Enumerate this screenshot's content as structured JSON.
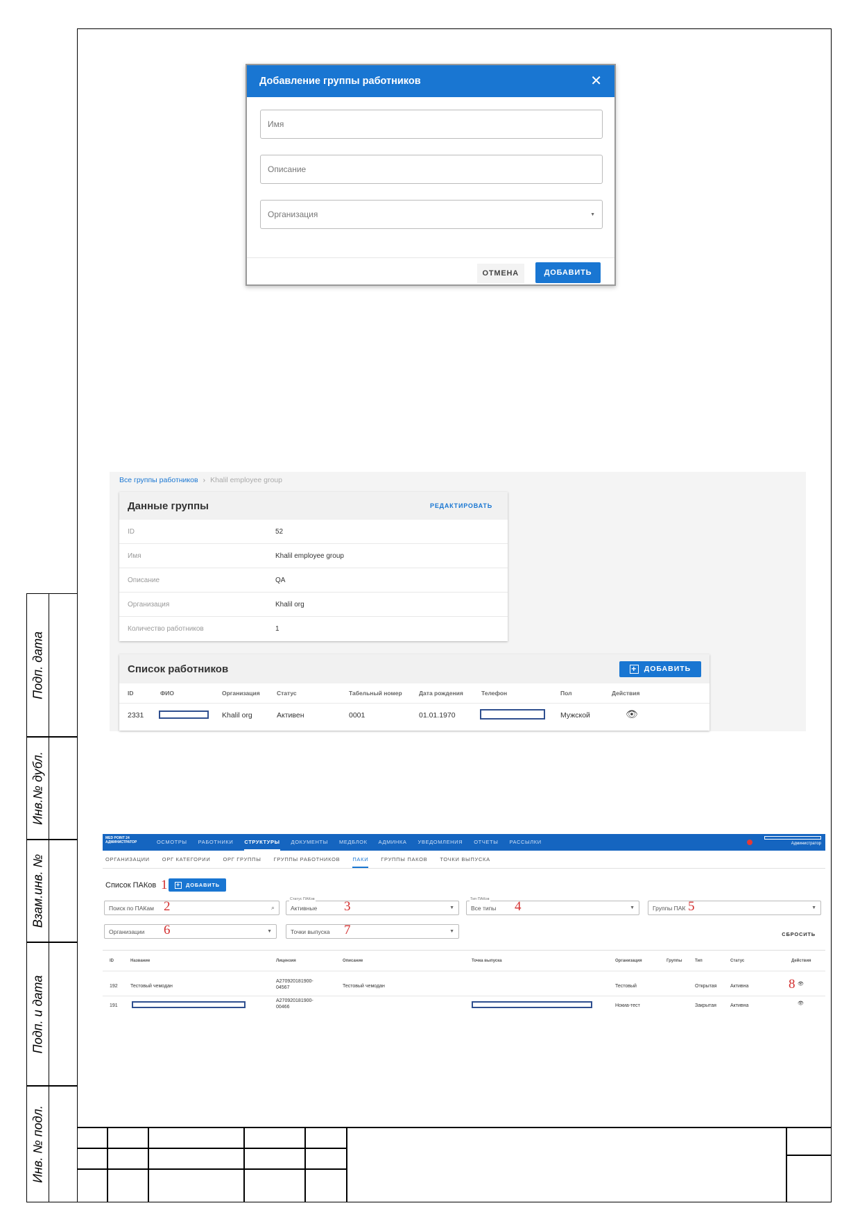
{
  "stamp": {
    "labels": [
      "Подп. дата",
      "Инв.№ дубл.",
      "Взам.инв. №",
      "Подп. и дата",
      "Инв. № подл."
    ]
  },
  "modal": {
    "title": "Добавление группы работников",
    "close_icon": "close-icon",
    "fields": {
      "name_placeholder": "Имя",
      "description_placeholder": "Описание",
      "organization_placeholder": "Организация"
    },
    "cancel_label": "ОТМЕНА",
    "add_label": "ДОБАВИТЬ"
  },
  "group_details": {
    "breadcrumb": {
      "root": "Все группы работников",
      "separator": "›",
      "current": "Khalil employee group"
    },
    "data_card": {
      "title": "Данные группы",
      "edit_label": "РЕДАКТИРОВАТЬ",
      "rows": [
        {
          "key": "ID",
          "value": "52"
        },
        {
          "key": "Имя",
          "value": "Khalil employee group"
        },
        {
          "key": "Описание",
          "value": "QA"
        },
        {
          "key": "Организация",
          "value": "Khalil org"
        },
        {
          "key": "Количество работников",
          "value": "1"
        }
      ]
    },
    "employees_card": {
      "title": "Список работников",
      "add_label": "ДОБАВИТЬ",
      "columns": [
        "ID",
        "ФИО",
        "Организация",
        "Статус",
        "Табельный номер",
        "Дата рождения",
        "Телефон",
        "Пол",
        "Действия"
      ],
      "rows": [
        {
          "id": "2331",
          "organization": "Khalil org",
          "status": "Активен",
          "tab_number": "0001",
          "birth_date": "01.01.1970",
          "gender": "Мужской",
          "action_icon": "eye-icon"
        }
      ]
    }
  },
  "pak_list": {
    "logo": {
      "line1": "MED POINT 24",
      "line2": "АДМИНИСТРАТОР"
    },
    "menu": [
      "ОСМОТРЫ",
      "РАБОТНИКИ",
      "СТРУКТУРЫ",
      "ДОКУМЕНТЫ",
      "МЕДБЛОК",
      "АДМИНКА",
      "УВЕДОМЛЕНИЯ",
      "ОТЧЕТЫ",
      "РАССЫЛКИ"
    ],
    "menu_active": "СТРУКТУРЫ",
    "user_role": "Администратор",
    "subnav": [
      "ОРГАНИЗАЦИИ",
      "ОРГ КАТЕГОРИИ",
      "ОРГ ГРУППЫ",
      "ГРУППЫ РАБОТНИКОВ",
      "ПАКИ",
      "ГРУППЫ ПАКОВ",
      "ТОЧКИ ВЫПУСКА"
    ],
    "subnav_active": "ПАКИ",
    "title": "Список ПАКов",
    "add_label": "ДОБАВИТЬ",
    "filters": {
      "search_placeholder": "Поиск по ПАКам",
      "status_legend": "Статус ПАКов",
      "status_value": "Активные",
      "type_legend": "Тип ПАКов",
      "type_value": "Все типы",
      "groups_placeholder": "Группы ПАК",
      "orgs_placeholder": "Организации",
      "points_placeholder": "Точки выпуска",
      "reset_label": "СБРОСИТЬ"
    },
    "callouts": [
      "1",
      "2",
      "3",
      "4",
      "5",
      "6",
      "7",
      "8"
    ],
    "columns": [
      "ID",
      "Название",
      "Лицензия",
      "Описание",
      "Точка выпуска",
      "Организация",
      "Группы",
      "Тип",
      "Статус",
      "Действия"
    ],
    "rows": [
      {
        "id": "192",
        "name": "Тестовый чемодан",
        "license1": "A270920181900-",
        "license2": "04567",
        "description": "Тестовый чемодан",
        "organization": "Тестовый",
        "type": "Открытая",
        "status": "Активна"
      },
      {
        "id": "191",
        "license1": "A270920181900-",
        "license2": "00466",
        "organization": "Нокиа-тест",
        "type": "Закрытая",
        "status": "Активна"
      }
    ]
  }
}
